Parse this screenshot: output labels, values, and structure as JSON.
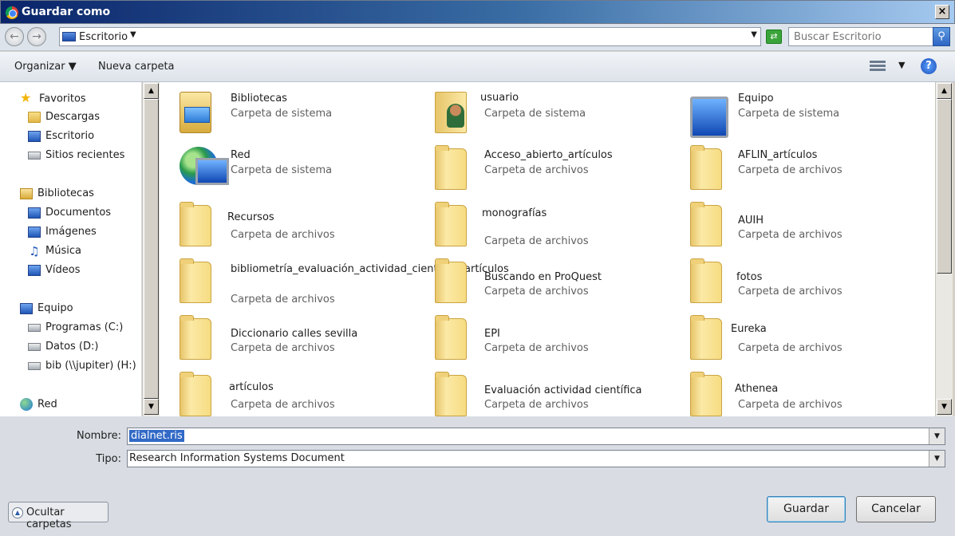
{
  "window": {
    "title": "Guardar como",
    "close": "×"
  },
  "address": {
    "location": "Escritorio",
    "search_placeholder": "Buscar Escritorio"
  },
  "toolbar": {
    "organize": "Organizar",
    "new_folder": "Nueva carpeta",
    "help": "?"
  },
  "sidebar": {
    "favorites": {
      "label": "Favoritos",
      "items": [
        "Descargas",
        "Escritorio",
        "Sitios recientes"
      ]
    },
    "libraries": {
      "label": "Bibliotecas",
      "items": [
        "Documentos",
        "Imágenes",
        "Música",
        "Vídeos"
      ]
    },
    "computer": {
      "label": "Equipo",
      "items": [
        "Programas (C:)",
        "Datos (D:)",
        "bib (\\\\jupiter) (H:)"
      ]
    },
    "network": {
      "label": "Red"
    }
  },
  "files": [
    {
      "name": "Bibliotecas",
      "type": "Carpeta de sistema",
      "icon": "library-icon"
    },
    {
      "name": "usuario",
      "type": "Carpeta de sistema",
      "icon": "user-folder-icon"
    },
    {
      "name": "Equipo",
      "type": "Carpeta de sistema",
      "icon": "computer-icon"
    },
    {
      "name": "Red",
      "type": "Carpeta de sistema",
      "icon": "network-icon"
    },
    {
      "name": "Acceso_abierto_artículos",
      "type": "Carpeta de archivos",
      "icon": "folder-icon"
    },
    {
      "name": "AFLIN_artículos",
      "type": "Carpeta de archivos",
      "icon": "folder-icon"
    },
    {
      "name": "Recursos",
      "type": "Carpeta de archivos",
      "icon": "folder-icon"
    },
    {
      "name": "monografías",
      "type": "Carpeta de archivos",
      "icon": "folder-icon"
    },
    {
      "name": "AUIH",
      "type": "Carpeta de archivos",
      "icon": "folder-icon"
    },
    {
      "name": "bibliometría_evaluación_actividad_científica_artículos",
      "type": "Carpeta de archivos",
      "icon": "folder-icon"
    },
    {
      "name": "Buscando en ProQuest",
      "type": "Carpeta de archivos",
      "icon": "folder-icon"
    },
    {
      "name": "fotos",
      "type": "Carpeta de archivos",
      "icon": "folder-icon"
    },
    {
      "name": "Diccionario calles sevilla",
      "type": "Carpeta de archivos",
      "icon": "folder-icon"
    },
    {
      "name": "EPI",
      "type": "Carpeta de archivos",
      "icon": "folder-icon"
    },
    {
      "name": "Eureka",
      "type": "Carpeta de archivos",
      "icon": "folder-icon"
    },
    {
      "name": "artículos",
      "type": "Carpeta de archivos",
      "icon": "folder-icon"
    },
    {
      "name": "Evaluación actividad científica",
      "type": "Carpeta de archivos",
      "icon": "folder-icon"
    },
    {
      "name": "Athenea",
      "type": "Carpeta de archivos",
      "icon": "folder-icon"
    }
  ],
  "form": {
    "name_label": "Nombre:",
    "name_value": "dialnet.ris",
    "type_label": "Tipo:",
    "type_value": "Research Information Systems Document"
  },
  "buttons": {
    "hide_folders": "Ocultar carpetas",
    "save": "Guardar",
    "cancel": "Cancelar"
  }
}
